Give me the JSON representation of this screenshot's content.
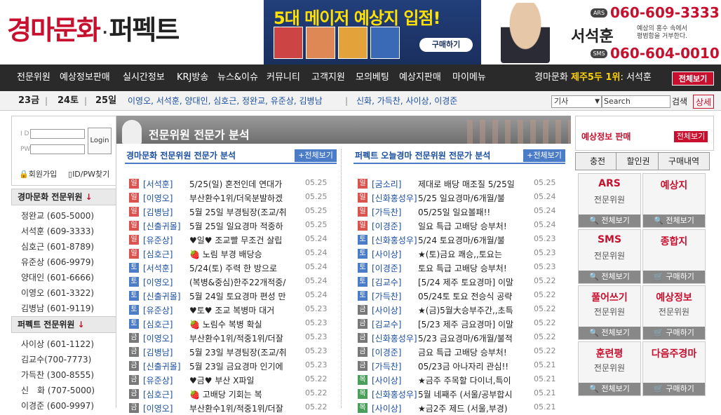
{
  "header": {
    "logo_part1": "경마문화",
    "logo_part2": "퍼펙트",
    "banner_title": "5대 메이저 예상지 입점!",
    "banner_buy": "구매하기",
    "ad_name": "서석훈",
    "ad_sub_line1": "예상의 홍수 속에서",
    "ad_sub_line2": "평범함을 거부한다.",
    "ad_ars_tag": "ARS",
    "ad_ars_phone": "060-609-3333",
    "ad_sms_tag": "SMS",
    "ad_sms_phone": "060-604-0010"
  },
  "nav": {
    "items": [
      "전문위원",
      "예상정보판매",
      "실시간정보",
      "KRJ방송",
      "뉴스&이슈",
      "커뮤니티",
      "고객지원",
      "모의베팅",
      "예상지판매",
      "마이메뉴"
    ],
    "rank_prefix": "경마문화",
    "rank_highlight": "제주5두 1위",
    "rank_name": ": 서석훈",
    "all_button": "전체보기"
  },
  "subbar": {
    "days": [
      "23금",
      "24토",
      "25일"
    ],
    "experts_group1": "이영오, 서석훈, 양대인, 심호근, 정완교, 유준상, 김병남",
    "experts_group2": "신화, 가득찬, 사이상, 이경준",
    "search_select": "기사",
    "search_placeholder": "Search",
    "search_button": "검색",
    "detail_button": "상세"
  },
  "left": {
    "id_label": "I D",
    "pw_label": "PW",
    "login_button": "Login",
    "join_link": "회원가입",
    "find_link": "ID/PW찾기",
    "group1_title": "경마문화 전문위원",
    "group1": [
      "정완교 (605-5000)",
      "서석훈 (609-3333)",
      "심호근 (601-8789)",
      "유준상 (606-9979)",
      "양대인 (601-6666)",
      "이영오 (601-3322)",
      "김병남 (601-9119)"
    ],
    "group2_title": "퍼펙트 전문위원",
    "group2": [
      "사이상 (601-1122)",
      "김교수(700-7773)",
      "가득찬 (300-8555)",
      "신　화 (707-5000)",
      "이경준 (600-9997)"
    ]
  },
  "main": {
    "title": "전문위원 전문가 분석",
    "left_heading": "경마문화 전문위원 전문가 분석",
    "right_heading": "퍼펙트 오늘경마 전문위원 전문가 분석",
    "more": "+전체보기",
    "left_rows": [
      {
        "day": "일",
        "author": "[서석훈]",
        "title": "5/25(일) 혼전인데 연대가",
        "date": "05.25"
      },
      {
        "day": "일",
        "author": "[이영오]",
        "title": "부산환수1위/더욱분발하겠",
        "date": "05.25"
      },
      {
        "day": "일",
        "author": "[김병남]",
        "title": "5월 25일 부경팀장(조교/취",
        "date": "05.25"
      },
      {
        "day": "일",
        "author": "[신출귀몰]",
        "title": "5월 25일 일요경마 적중하",
        "date": "05.25"
      },
      {
        "day": "일",
        "author": "[유준상]",
        "title": "♥일♥ 조교빨 무조건 살립",
        "date": "05.24"
      },
      {
        "day": "일",
        "author": "[심호근]",
        "title": "🍓 노림 부경 배당승",
        "date": "05.24"
      },
      {
        "day": "토",
        "author": "[서석훈]",
        "title": "5/24(토) 주력 한 방으로",
        "date": "05.24"
      },
      {
        "day": "토",
        "author": "[이영오]",
        "title": "(복병&중심)한주22개적중/",
        "date": "05.24"
      },
      {
        "day": "토",
        "author": "[신출귀몰]",
        "title": "5월 24일 토요경마 편성 만",
        "date": "05.24"
      },
      {
        "day": "토",
        "author": "[유준상]",
        "title": "♥토♥ 조교 복병마 대거",
        "date": "05.23"
      },
      {
        "day": "토",
        "author": "[심호근]",
        "title": "🍓 노림수 복병 확실",
        "date": "05.23"
      },
      {
        "day": "금",
        "author": "[이영오]",
        "title": "부산환수1위/적중1위/더잘",
        "date": "05.23"
      },
      {
        "day": "금",
        "author": "[김병남]",
        "title": "5월 23일 부경팀장(조교/취",
        "date": "05.23"
      },
      {
        "day": "금",
        "author": "[신출귀몰]",
        "title": "5월 23일 금요경마 인기에",
        "date": "05.23"
      },
      {
        "day": "금",
        "author": "[유준상]",
        "title": "♥금♥ 부산 X파일",
        "date": "05.22"
      },
      {
        "day": "금",
        "author": "[심호근]",
        "title": "🍓 고배당 기회는 복",
        "date": "05.22"
      },
      {
        "day": "금",
        "author": "[이영오]",
        "title": "부산환수1위/적중1위/더잘",
        "date": "05.22"
      }
    ],
    "right_rows": [
      {
        "day": "일",
        "author": "[굼소리]",
        "title": "제대로 배당 매조질 5/25일",
        "date": "05.25"
      },
      {
        "day": "일",
        "author": "[신화홍성우]",
        "title": "5/25 일요경마/6개월/불",
        "date": "05.24"
      },
      {
        "day": "일",
        "author": "[가득찬]",
        "title": "05/25일 일요볼패!!",
        "date": "05.24"
      },
      {
        "day": "일",
        "author": "[이경준]",
        "title": "일요 특급 고배당 승부처!",
        "date": "05.24"
      },
      {
        "day": "토",
        "author": "[신화홍성우]",
        "title": "5/24 토요경마/6개월/불",
        "date": "05.23"
      },
      {
        "day": "토",
        "author": "[사이상]",
        "title": "★(토)금요 쾌승,,토요는",
        "date": "05.23"
      },
      {
        "day": "토",
        "author": "[이경준]",
        "title": "토요 특급 고배당 승부처!",
        "date": "05.23"
      },
      {
        "day": "토",
        "author": "[김교수]",
        "title": "[5/24 제주 토요경마] 이말",
        "date": "05.22"
      },
      {
        "day": "토",
        "author": "[가득찬]",
        "title": "05/24토 토요 전승식 공략",
        "date": "05.22"
      },
      {
        "day": "금",
        "author": "[사이상]",
        "title": "★(금)5월大승부주간,,초특",
        "date": "05.22"
      },
      {
        "day": "금",
        "author": "[김교수]",
        "title": "[5/23 제주 금요경마] 이말",
        "date": "05.22"
      },
      {
        "day": "금",
        "author": "[신화홍성우]",
        "title": "5/23 금요경마/6개월/불적",
        "date": "05.22"
      },
      {
        "day": "금",
        "author": "[이경준]",
        "title": "금요 특급 고배당 승부처!",
        "date": "05.22"
      },
      {
        "day": "금",
        "author": "[가득찬]",
        "title": "05/23금 아나자리 관심!!",
        "date": "05.21"
      },
      {
        "day": "목",
        "author": "[사이상]",
        "title": "★금주 주목할 다이너,특이",
        "date": "05.21"
      },
      {
        "day": "목",
        "author": "[신화홍성우]",
        "title": "5월 네째주 (서울/공부합시",
        "date": "05.21"
      },
      {
        "day": "목",
        "author": "[사이상]",
        "title": "★금2주 제드 (서울,부경)",
        "date": "05.21"
      }
    ]
  },
  "right": {
    "title": "예상정보 판매",
    "all_button": "전체보기",
    "tabs": [
      "충전",
      "할인권",
      "구매내역"
    ],
    "cards": [
      {
        "name": "ARS",
        "sub": "전문위원",
        "btn": "전체보기"
      },
      {
        "name": "예상지",
        "sub": "",
        "btn": "전체보기"
      },
      {
        "name": "SMS",
        "sub": "전문위원",
        "btn": "전체보기"
      },
      {
        "name": "종합지",
        "sub": "",
        "btn": "구매하기"
      },
      {
        "name": "풀어쓰기",
        "sub": "전문위원",
        "btn": "전체보기"
      },
      {
        "name": "예상정보",
        "sub": "전문위원",
        "btn": "구매하기"
      },
      {
        "name": "훈련평",
        "sub": "전문위원",
        "btn": "전체보기"
      },
      {
        "name": "다음주경마",
        "sub": "",
        "btn": "구매하기"
      }
    ]
  },
  "colors": {
    "brand": "#c8102e",
    "link": "#1a4fa0",
    "badge_sun": "#d9534f",
    "badge_sat": "#4a7cc7",
    "badge_fri": "#777777",
    "badge_thu": "#4aa05a"
  }
}
